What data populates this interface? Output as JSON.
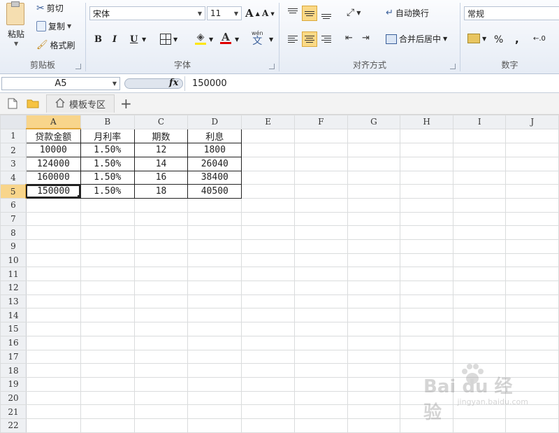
{
  "ribbon": {
    "clipboard": {
      "label": "剪贴板",
      "paste": "粘贴",
      "cut": "剪切",
      "copy": "复制",
      "format_painter": "格式刷"
    },
    "font": {
      "label": "字体",
      "font_name": "宋体",
      "font_size": "11",
      "bold": "B",
      "italic": "I",
      "underline": "U",
      "font_color": "#e00000",
      "fill_color": "#ffe600"
    },
    "alignment": {
      "label": "对齐方式",
      "wrap_text": "自动换行",
      "merge_center": "合并后居中"
    },
    "number": {
      "label": "数字",
      "format": "常规",
      "percent": "%",
      "comma": ","
    }
  },
  "formula_bar": {
    "name_box": "A5",
    "fx": "fx",
    "content": "150000"
  },
  "tabstrip": {
    "tab_label": "模板专区"
  },
  "grid": {
    "columns": [
      "A",
      "B",
      "C",
      "D",
      "E",
      "F",
      "G",
      "H",
      "I",
      "J"
    ],
    "rows": [
      "1",
      "2",
      "3",
      "4",
      "5",
      "6",
      "7",
      "8",
      "9",
      "10",
      "11",
      "12",
      "13",
      "14",
      "15",
      "16",
      "17",
      "18",
      "19",
      "20",
      "21",
      "22"
    ],
    "header": [
      "贷款金额",
      "月利率",
      "期数",
      "利息"
    ],
    "data": [
      [
        "10000",
        "1.50%",
        "12",
        "1800"
      ],
      [
        "124000",
        "1.50%",
        "14",
        "26040"
      ],
      [
        "160000",
        "1.50%",
        "16",
        "38400"
      ],
      [
        "150000",
        "1.50%",
        "18",
        "40500"
      ]
    ],
    "selected_column": "A",
    "selected_row": "5"
  },
  "watermark": {
    "text": "Bai du 经验",
    "sub": "jingyan.baidu.com"
  }
}
